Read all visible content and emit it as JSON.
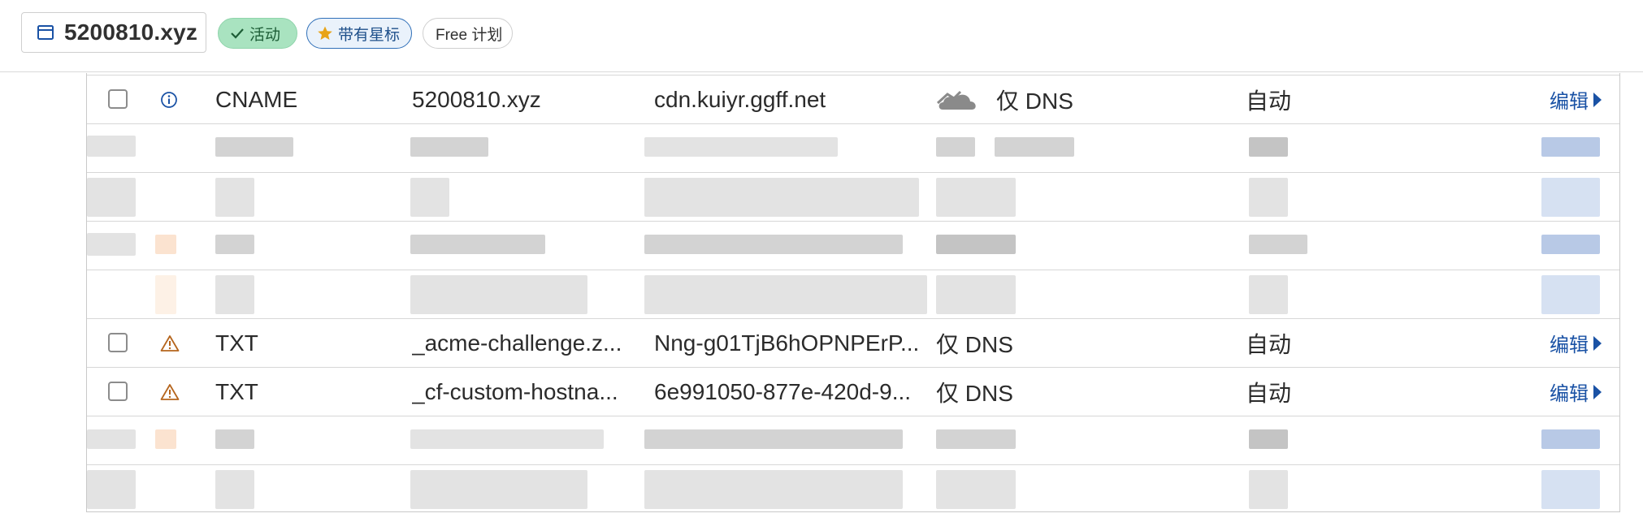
{
  "header": {
    "zone_name": "5200810.xyz",
    "status_label": "活动",
    "starred_label": "带有星标",
    "plan_label": "Free 计划"
  },
  "records": [
    {
      "type": "CNAME",
      "name": "5200810.xyz",
      "content": "cdn.kuiyr.ggff.net",
      "proxy_status": "仅 DNS",
      "ttl": "自动",
      "edit_label": "编辑",
      "icon": "info-icon"
    },
    {
      "type": "TXT",
      "name": "_acme-challenge.z...",
      "content": "Nng-g01TjB6hOPNPErP...",
      "proxy_status": "仅 DNS",
      "ttl": "自动",
      "edit_label": "编辑",
      "icon": "warning-icon"
    },
    {
      "type": "TXT",
      "name": "_cf-custom-hostna...",
      "content": "6e991050-877e-420d-9...",
      "proxy_status": "仅 DNS",
      "ttl": "自动",
      "edit_label": "编辑",
      "icon": "warning-icon"
    }
  ],
  "colors": {
    "active_badge": "#a9e3c0",
    "star": "#e8a317",
    "link": "#1a52a5",
    "warning": "#b5651d",
    "info": "#1a52a5"
  }
}
